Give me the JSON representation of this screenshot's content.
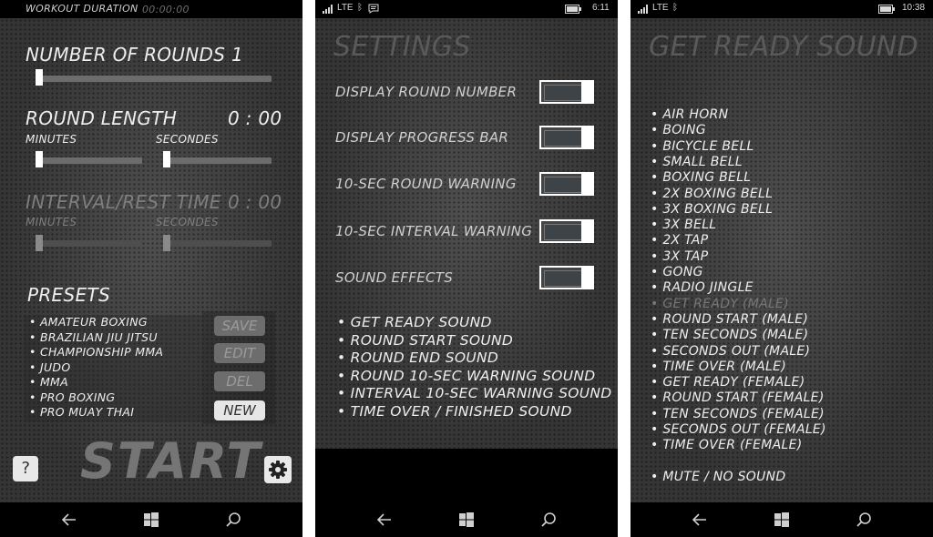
{
  "screen1": {
    "workout_duration_label": "WORKOUT DURATION",
    "workout_duration_value": "00:00:00",
    "rounds_label": "NUMBER OF ROUNDS",
    "rounds_value": "1",
    "round_length_label": "ROUND LENGTH",
    "round_length_value": "0 : 00",
    "minutes_label": "MINUTES",
    "seconds_label": "SECONDES",
    "interval_label": "INTERVAL/REST TIME",
    "interval_value": "0 : 00",
    "interval_minutes_label": "MINUTES",
    "interval_seconds_label": "SECONDES",
    "presets_title": "PRESETS",
    "presets": [
      "AMATEUR BOXING",
      "BRAZILIAN JIU JITSU",
      "CHAMPIONSHIP MMA",
      "JUDO",
      "MMA",
      "PRO BOXING",
      "PRO MUAY THAI"
    ],
    "save_label": "SAVE",
    "edit_label": "EDIT",
    "del_label": "DEL",
    "new_label": "NEW",
    "help_label": "?",
    "start_label": "START"
  },
  "screen2": {
    "status_network": "LTE",
    "status_time": "6:11",
    "title": "SETTINGS",
    "toggles": [
      "DISPLAY ROUND NUMBER",
      "DISPLAY PROGRESS BAR",
      "10-SEC ROUND WARNING",
      "10-SEC INTERVAL WARNING",
      "SOUND EFFECTS"
    ],
    "sound_items": [
      "GET READY SOUND",
      "ROUND START SOUND",
      "ROUND END SOUND",
      "ROUND 10-SEC WARNING SOUND",
      "INTERVAL 10-SEC WARNING SOUND",
      "TIME OVER / FINISHED SOUND"
    ]
  },
  "screen3": {
    "status_network": "LTE",
    "status_time": "10:38",
    "title": "GET READY SOUND",
    "sounds": [
      "AIR HORN",
      "BOING",
      "BICYCLE BELL",
      "SMALL BELL",
      "BOXING BELL",
      "2X BOXING BELL",
      "3X BOXING BELL",
      "3X BELL",
      "2X TAP",
      "3X TAP",
      "GONG",
      "RADIO JINGLE",
      "GET READY (MALE)",
      "ROUND START (MALE)",
      "TEN SECONDS (MALE)",
      "SECONDS OUT (MALE)",
      "TIME OVER (MALE)",
      "GET READY (FEMALE)",
      "ROUND START (FEMALE)",
      "TEN SECONDS (FEMALE)",
      "SECONDS OUT (FEMALE)",
      "TIME OVER (FEMALE)"
    ],
    "mute_label": "MUTE / NO SOUND",
    "selected_index": 12
  },
  "icons": {
    "back": "back-arrow-icon",
    "home": "windows-logo-icon",
    "search": "search-icon",
    "settings": "gear-icon"
  },
  "colors": {
    "text": "#eeeeee",
    "dim_text": "#888888",
    "background": "#3b3b3b"
  }
}
